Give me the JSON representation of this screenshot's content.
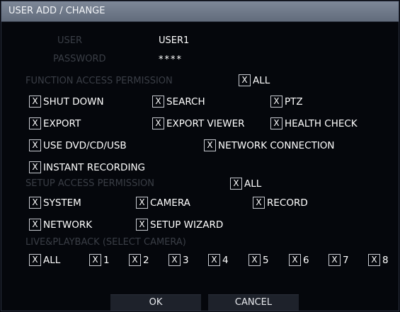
{
  "window": {
    "title": "USER ADD / CHANGE"
  },
  "user": {
    "label": "USER",
    "value": "USER1"
  },
  "password": {
    "label": "PASSWORD",
    "value": "****"
  },
  "check_mark": "X",
  "function_access": {
    "heading": "FUNCTION ACCESS PERMISSION",
    "all_label": "ALL",
    "items": [
      {
        "label": "SHUT DOWN",
        "checked": true
      },
      {
        "label": "SEARCH",
        "checked": true
      },
      {
        "label": "PTZ",
        "checked": true
      },
      {
        "label": "EXPORT",
        "checked": true
      },
      {
        "label": "EXPORT VIEWER",
        "checked": true
      },
      {
        "label": "HEALTH CHECK",
        "checked": true
      },
      {
        "label": "USE DVD/CD/USB",
        "checked": true
      },
      {
        "label": "NETWORK CONNECTION",
        "checked": true
      },
      {
        "label": "INSTANT RECORDING",
        "checked": true
      }
    ]
  },
  "setup_access": {
    "heading": "SETUP ACCESS PERMISSION",
    "all_label": "ALL",
    "items": [
      {
        "label": "SYSTEM",
        "checked": true
      },
      {
        "label": "CAMERA",
        "checked": true
      },
      {
        "label": "RECORD",
        "checked": true
      },
      {
        "label": "NETWORK",
        "checked": true
      },
      {
        "label": "SETUP WIZARD",
        "checked": true
      }
    ]
  },
  "live_playback": {
    "heading": "LIVE&PLAYBACK (SELECT CAMERA)",
    "all_label": "ALL",
    "cameras": [
      "1",
      "2",
      "3",
      "4",
      "5",
      "6",
      "7",
      "8"
    ]
  },
  "buttons": {
    "ok": "OK",
    "cancel": "CANCEL"
  }
}
